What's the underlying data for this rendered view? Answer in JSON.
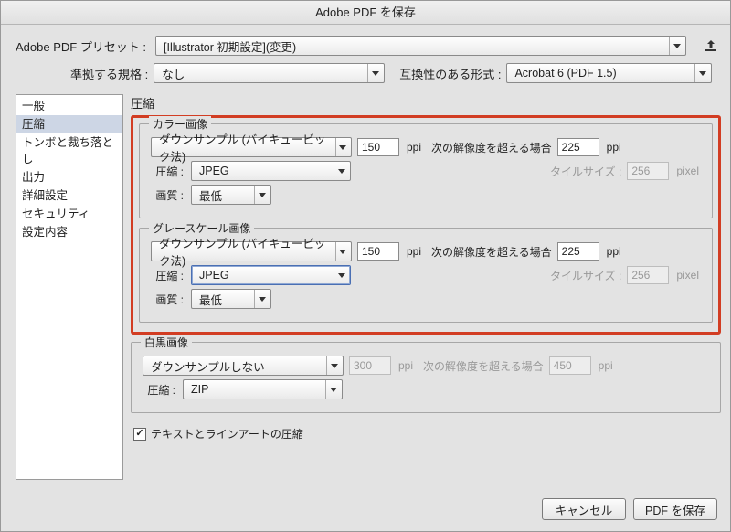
{
  "title": "Adobe PDF を保存",
  "preset": {
    "label": "Adobe PDF プリセット :",
    "value": "[Illustrator 初期設定](変更)"
  },
  "standard": {
    "label": "準拠する規格 :",
    "value": "なし"
  },
  "compat": {
    "label": "互換性のある形式 :",
    "value": "Acrobat 6 (PDF 1.5)"
  },
  "sidebar": {
    "items": [
      "一般",
      "圧縮",
      "トンボと裁ち落とし",
      "出力",
      "詳細設定",
      "セキュリティ",
      "設定内容"
    ],
    "selected_index": 1
  },
  "section_title": "圧縮",
  "labels": {
    "compression": "圧縮 :",
    "quality": "画質 :",
    "tile_size": "タイルサイズ :",
    "ppi": "ppi",
    "pixel": "pixel",
    "threshold": "次の解像度を超える場合"
  },
  "groups": {
    "color": {
      "legend": "カラー画像",
      "downsample": "ダウンサンプル (バイキュービック法)",
      "dpi": "150",
      "threshold_dpi": "225",
      "compression": "JPEG",
      "tile_size": "256",
      "quality": "最低"
    },
    "gray": {
      "legend": "グレースケール画像",
      "downsample": "ダウンサンプル (バイキュービック法)",
      "dpi": "150",
      "threshold_dpi": "225",
      "compression": "JPEG",
      "tile_size": "256",
      "quality": "最低"
    },
    "mono": {
      "legend": "白黒画像",
      "downsample": "ダウンサンプルしない",
      "dpi": "300",
      "threshold_dpi": "450",
      "compression": "ZIP"
    }
  },
  "checkbox_label": "テキストとラインアートの圧縮",
  "buttons": {
    "cancel": "キャンセル",
    "save": "PDF を保存"
  }
}
